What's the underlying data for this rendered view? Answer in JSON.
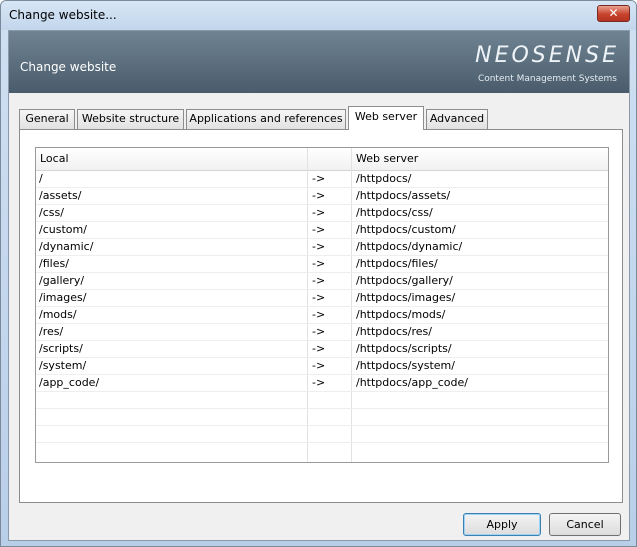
{
  "window": {
    "title": "Change website...",
    "close_glyph": "✕"
  },
  "banner": {
    "title": "Change website",
    "brand_name": "NEOSENSE",
    "brand_tagline": "Content Management Systems"
  },
  "tabs": [
    {
      "label": "General"
    },
    {
      "label": "Website structure"
    },
    {
      "label": "Applications and references"
    },
    {
      "label": "Web server",
      "active": true
    },
    {
      "label": "Advanced"
    }
  ],
  "table": {
    "headers": [
      "Local",
      "",
      "Web server"
    ],
    "rows": [
      {
        "local": "/",
        "arrow": "->",
        "web": "/httpdocs/"
      },
      {
        "local": "/assets/",
        "arrow": "->",
        "web": "/httpdocs/assets/"
      },
      {
        "local": "/css/",
        "arrow": "->",
        "web": "/httpdocs/css/"
      },
      {
        "local": "/custom/",
        "arrow": "->",
        "web": "/httpdocs/custom/"
      },
      {
        "local": "/dynamic/",
        "arrow": "->",
        "web": "/httpdocs/dynamic/"
      },
      {
        "local": "/files/",
        "arrow": "->",
        "web": "/httpdocs/files/"
      },
      {
        "local": "/gallery/",
        "arrow": "->",
        "web": "/httpdocs/gallery/"
      },
      {
        "local": "/images/",
        "arrow": "->",
        "web": "/httpdocs/images/"
      },
      {
        "local": "/mods/",
        "arrow": "->",
        "web": "/httpdocs/mods/"
      },
      {
        "local": "/res/",
        "arrow": "->",
        "web": "/httpdocs/res/"
      },
      {
        "local": "/scripts/",
        "arrow": "->",
        "web": "/httpdocs/scripts/"
      },
      {
        "local": "/system/",
        "arrow": "->",
        "web": "/httpdocs/system/"
      },
      {
        "local": "/app_code/",
        "arrow": "->",
        "web": "/httpdocs/app_code/"
      },
      {
        "local": "",
        "arrow": "",
        "web": ""
      },
      {
        "local": "",
        "arrow": "",
        "web": ""
      },
      {
        "local": "",
        "arrow": "",
        "web": ""
      }
    ]
  },
  "buttons": {
    "apply": "Apply",
    "cancel": "Cancel"
  }
}
